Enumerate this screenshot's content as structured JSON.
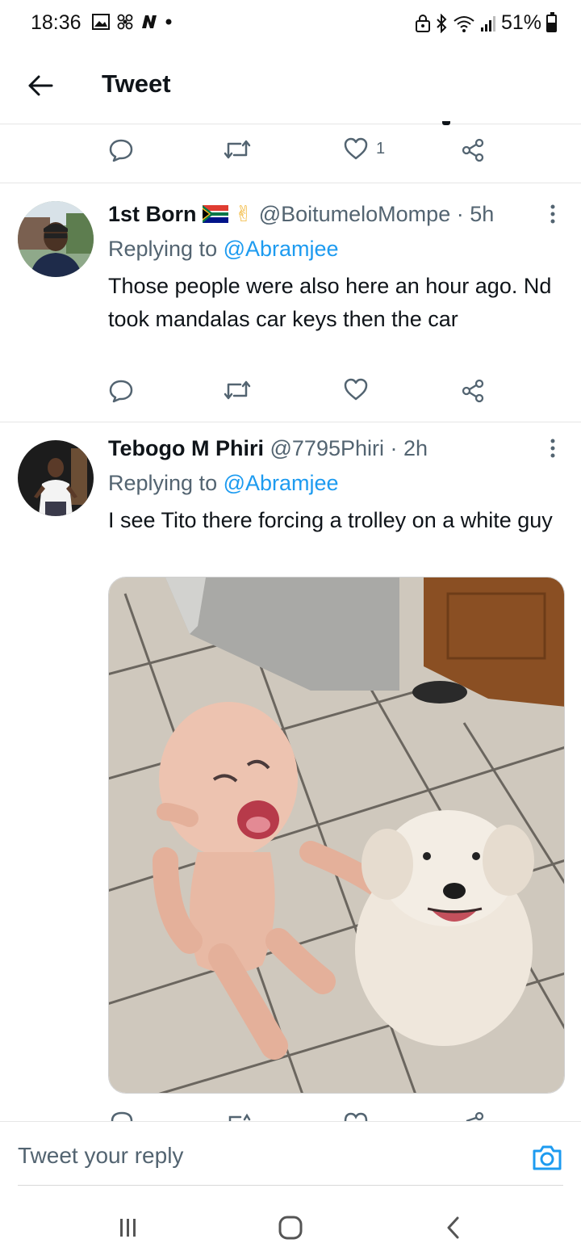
{
  "status_bar": {
    "time": "18:36",
    "battery": "51%",
    "battery_level": 0.51
  },
  "header": {
    "title": "Tweet"
  },
  "top_actions": {
    "like_count": "1"
  },
  "tweets": [
    {
      "name": "1st Born",
      "name_emoji": "✌",
      "handle": "@BoitumeloMompe · 5h",
      "replying_label": "Replying to ",
      "replying_to": "@Abramjee",
      "text": "Those people were also here an hour ago. Nd took mandalas car keys then the car"
    },
    {
      "name": "Tebogo M Phiri",
      "handle": "@7795Phiri · 2h",
      "replying_label": "Replying to ",
      "replying_to": "@Abramjee",
      "text": "I see Tito there forcing a trolley on a white guy"
    }
  ],
  "reply_bar": {
    "placeholder": "Tweet your reply"
  },
  "colors": {
    "accent": "#1d9bf0",
    "secondary_text": "#536471",
    "primary_text": "#0f1419"
  }
}
